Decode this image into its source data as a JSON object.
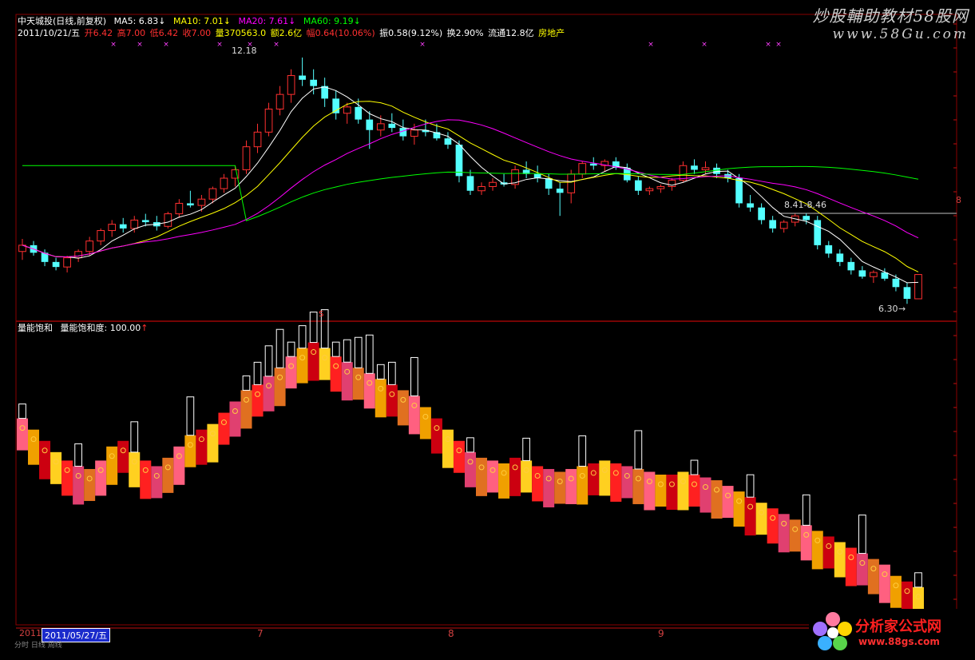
{
  "header": {
    "stock_title": "中天城投(日线,前复权)",
    "ma5": "MA5: 6.83↓",
    "ma10": "MA10: 7.01↓",
    "ma20": "MA20: 7.61↓",
    "ma60": "MA60: 9.19↓",
    "date": "2011/10/21/五",
    "open": "开6.42",
    "high": "高7.00",
    "low": "低6.42",
    "close": "收7.00",
    "volume": "量370563.0",
    "amount": "额2.6亿",
    "change": "幅0.64(10.06%)",
    "amplitude": "振0.58(9.12%)",
    "turnover": "换2.90%",
    "float": "流通12.8亿",
    "sector": "房地产"
  },
  "colors": {
    "ma5": "#ffffff",
    "ma10": "#ffff00",
    "ma20": "#ff00ff",
    "ma60": "#00ff00",
    "up": "#ff3030",
    "down": "#54ffff",
    "grid": "#8a0000"
  },
  "price_annotations": {
    "high_label": "12.18",
    "range_label": "8.41-8.46",
    "low_label": "6.30",
    "s_marker": "S",
    "right_edge_label": "8"
  },
  "indicator": {
    "name": "量能饱和",
    "title": "量能饱和度: 100.00",
    "arrow": "↑"
  },
  "xaxis": {
    "corner_label": "2011",
    "selected_date": "2011/05/27/五",
    "months": [
      "7",
      "8",
      "9"
    ]
  },
  "watermark": {
    "line1": "炒股輔助教材58股网",
    "line2": "www.58Gu.com"
  },
  "logo": {
    "name": "分析家公式网",
    "url": "www.88gs.com"
  },
  "bottom_strip": "分时  日线  周线",
  "chart_data": {
    "type": "candlestick",
    "series_price": [
      [
        7.55,
        7.85,
        7.35,
        7.7
      ],
      [
        7.7,
        7.8,
        7.45,
        7.52
      ],
      [
        7.52,
        7.6,
        7.2,
        7.3
      ],
      [
        7.3,
        7.4,
        7.1,
        7.18
      ],
      [
        7.18,
        7.45,
        7.05,
        7.4
      ],
      [
        7.4,
        7.6,
        7.3,
        7.55
      ],
      [
        7.55,
        7.9,
        7.45,
        7.8
      ],
      [
        7.8,
        8.1,
        7.7,
        8.05
      ],
      [
        8.05,
        8.3,
        7.9,
        8.2
      ],
      [
        8.2,
        8.35,
        8.0,
        8.1
      ],
      [
        8.1,
        8.4,
        8.0,
        8.3
      ],
      [
        8.3,
        8.45,
        8.15,
        8.25
      ],
      [
        8.25,
        8.4,
        8.05,
        8.15
      ],
      [
        8.15,
        8.5,
        8.1,
        8.45
      ],
      [
        8.45,
        8.8,
        8.35,
        8.7
      ],
      [
        8.7,
        9.0,
        8.6,
        8.65
      ],
      [
        8.65,
        8.9,
        8.5,
        8.8
      ],
      [
        8.8,
        9.1,
        8.7,
        9.05
      ],
      [
        9.05,
        9.4,
        8.95,
        9.3
      ],
      [
        9.3,
        9.6,
        9.1,
        9.5
      ],
      [
        9.5,
        10.2,
        9.4,
        10.05
      ],
      [
        10.05,
        10.6,
        9.9,
        10.4
      ],
      [
        10.4,
        11.1,
        10.3,
        10.95
      ],
      [
        10.95,
        11.5,
        10.8,
        11.3
      ],
      [
        11.3,
        11.9,
        11.1,
        11.75
      ],
      [
        11.75,
        12.18,
        11.5,
        11.65
      ],
      [
        11.65,
        11.9,
        11.3,
        11.5
      ],
      [
        11.5,
        11.7,
        11.0,
        11.2
      ],
      [
        11.2,
        11.4,
        10.7,
        10.85
      ],
      [
        10.85,
        11.1,
        10.6,
        11.0
      ],
      [
        11.0,
        11.2,
        10.6,
        10.7
      ],
      [
        10.7,
        10.9,
        10.0,
        10.45
      ],
      [
        10.45,
        10.8,
        10.3,
        10.6
      ],
      [
        10.6,
        10.85,
        10.4,
        10.5
      ],
      [
        10.5,
        10.7,
        10.2,
        10.3
      ],
      [
        10.3,
        10.6,
        10.1,
        10.45
      ],
      [
        10.45,
        10.7,
        10.3,
        10.4
      ],
      [
        10.4,
        10.6,
        10.2,
        10.25
      ],
      [
        10.25,
        10.4,
        10.0,
        10.1
      ],
      [
        10.1,
        10.2,
        9.2,
        9.35
      ],
      [
        9.35,
        9.5,
        8.9,
        9.0
      ],
      [
        9.0,
        9.2,
        8.9,
        9.1
      ],
      [
        9.1,
        9.3,
        9.0,
        9.2
      ],
      [
        9.2,
        9.4,
        9.1,
        9.15
      ],
      [
        9.15,
        9.6,
        9.05,
        9.5
      ],
      [
        9.5,
        9.7,
        9.3,
        9.4
      ],
      [
        9.4,
        9.6,
        9.2,
        9.3
      ],
      [
        9.3,
        9.4,
        8.9,
        9.05
      ],
      [
        9.05,
        9.2,
        8.4,
        8.95
      ],
      [
        8.95,
        9.5,
        8.7,
        9.4
      ],
      [
        9.4,
        9.7,
        9.3,
        9.65
      ],
      [
        9.65,
        9.8,
        9.5,
        9.6
      ],
      [
        9.6,
        9.75,
        9.45,
        9.7
      ],
      [
        9.7,
        9.8,
        9.5,
        9.55
      ],
      [
        9.55,
        9.65,
        9.2,
        9.25
      ],
      [
        9.25,
        9.35,
        8.9,
        9.0
      ],
      [
        9.0,
        9.1,
        8.9,
        9.05
      ],
      [
        9.05,
        9.15,
        8.95,
        9.1
      ],
      [
        9.1,
        9.3,
        9.0,
        9.25
      ],
      [
        9.25,
        9.7,
        9.2,
        9.6
      ],
      [
        9.6,
        9.75,
        9.4,
        9.5
      ],
      [
        9.5,
        9.7,
        9.4,
        9.55
      ],
      [
        9.55,
        9.65,
        9.3,
        9.4
      ],
      [
        9.4,
        9.5,
        9.2,
        9.3
      ],
      [
        9.3,
        9.4,
        8.6,
        8.7
      ],
      [
        8.7,
        8.9,
        8.5,
        8.6
      ],
      [
        8.6,
        8.7,
        8.2,
        8.3
      ],
      [
        8.3,
        8.4,
        8.0,
        8.1
      ],
      [
        8.1,
        8.3,
        8.0,
        8.25
      ],
      [
        8.25,
        8.45,
        8.15,
        8.4
      ],
      [
        8.4,
        8.46,
        8.2,
        8.3
      ],
      [
        8.3,
        8.4,
        7.6,
        7.7
      ],
      [
        7.7,
        7.8,
        7.4,
        7.5
      ],
      [
        7.5,
        7.6,
        7.2,
        7.3
      ],
      [
        7.3,
        7.4,
        7.0,
        7.1
      ],
      [
        7.1,
        7.2,
        6.9,
        6.95
      ],
      [
        6.95,
        7.1,
        6.8,
        7.05
      ],
      [
        7.05,
        7.15,
        6.85,
        6.9
      ],
      [
        6.9,
        7.0,
        6.6,
        6.7
      ],
      [
        6.7,
        6.8,
        6.3,
        6.42
      ],
      [
        6.42,
        7.0,
        6.42,
        7.0
      ]
    ],
    "series_indicator": [
      70,
      66,
      62,
      58,
      55,
      53,
      52,
      55,
      60,
      62,
      58,
      55,
      53,
      56,
      60,
      64,
      66,
      68,
      72,
      76,
      80,
      82,
      85,
      88,
      92,
      95,
      97,
      95,
      92,
      90,
      88,
      86,
      84,
      82,
      80,
      78,
      74,
      70,
      66,
      62,
      58,
      56,
      55,
      54,
      56,
      55,
      53,
      52,
      51,
      52,
      53,
      54,
      55,
      54,
      53,
      52,
      51,
      50,
      50,
      51,
      50,
      49,
      48,
      46,
      44,
      42,
      40,
      38,
      36,
      34,
      32,
      30,
      28,
      26,
      24,
      22,
      20,
      18,
      14,
      12,
      10
    ],
    "ylim_price": [
      6.0,
      12.6
    ],
    "ylim_indicator": [
      0,
      100
    ]
  }
}
